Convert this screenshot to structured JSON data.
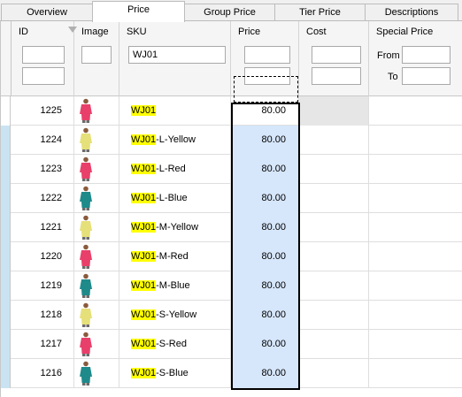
{
  "tabs": [
    {
      "label": "Overview",
      "active": false
    },
    {
      "label": "Price",
      "active": true
    },
    {
      "label": "Group Price",
      "active": false
    },
    {
      "label": "Tier Price",
      "active": false
    },
    {
      "label": "Descriptions",
      "active": false
    }
  ],
  "columns": {
    "id": "ID",
    "image": "Image",
    "sku": "SKU",
    "price": "Price",
    "cost": "Cost",
    "special_price": "Special Price"
  },
  "filters": {
    "sku_value": "WJ01",
    "special_from_label": "From",
    "special_to_label": "To"
  },
  "highlight_term": "WJ01",
  "shirt_colors": {
    "red": "#e8406a",
    "yellow": "#e6e07a",
    "blue": "#1f8a8a"
  },
  "rows": [
    {
      "id": "1225",
      "sku_suffix": "",
      "price": "80.00",
      "shirt": "red",
      "current": true
    },
    {
      "id": "1224",
      "sku_suffix": "-L-Yellow",
      "price": "80.00",
      "shirt": "yellow",
      "current": false
    },
    {
      "id": "1223",
      "sku_suffix": "-L-Red",
      "price": "80.00",
      "shirt": "red",
      "current": false
    },
    {
      "id": "1222",
      "sku_suffix": "-L-Blue",
      "price": "80.00",
      "shirt": "blue",
      "current": false
    },
    {
      "id": "1221",
      "sku_suffix": "-M-Yellow",
      "price": "80.00",
      "shirt": "yellow",
      "current": false
    },
    {
      "id": "1220",
      "sku_suffix": "-M-Red",
      "price": "80.00",
      "shirt": "red",
      "current": false
    },
    {
      "id": "1219",
      "sku_suffix": "-M-Blue",
      "price": "80.00",
      "shirt": "blue",
      "current": false
    },
    {
      "id": "1218",
      "sku_suffix": "-S-Yellow",
      "price": "80.00",
      "shirt": "yellow",
      "current": false
    },
    {
      "id": "1217",
      "sku_suffix": "-S-Red",
      "price": "80.00",
      "shirt": "red",
      "current": false
    },
    {
      "id": "1216",
      "sku_suffix": "-S-Blue",
      "price": "80.00",
      "shirt": "blue",
      "current": false
    }
  ]
}
